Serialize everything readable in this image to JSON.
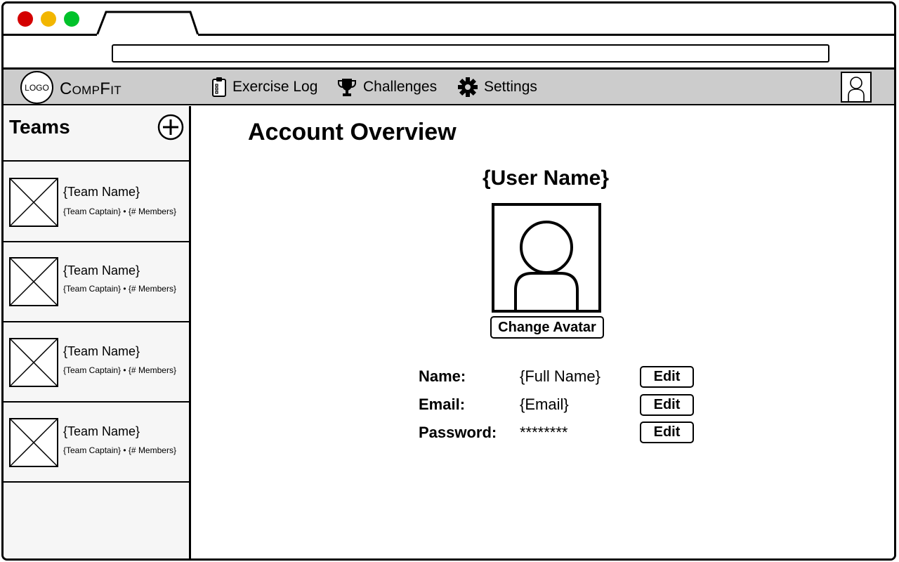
{
  "window": {
    "controls": {
      "close_color": "#d40000",
      "minimize_color": "#f2b600",
      "maximize_color": "#00c22a"
    },
    "tab_title": "",
    "url": ""
  },
  "nav": {
    "logo_text": "LOGO",
    "brand": "CompFit",
    "background": "#cccccc",
    "items": [
      {
        "label": "Exercise Log",
        "icon": "clipboard-icon"
      },
      {
        "label": "Challenges",
        "icon": "trophy-icon"
      },
      {
        "label": "Settings",
        "icon": "gear-icon"
      }
    ],
    "user_icon": "user-avatar-icon"
  },
  "sidebar": {
    "title": "Teams",
    "add_icon": "plus-circle-icon",
    "teams": [
      {
        "name": "{Team Name}",
        "meta": "{Team Captain} • {# Members}"
      },
      {
        "name": "{Team Name}",
        "meta": "{Team Captain} • {# Members}"
      },
      {
        "name": "{Team Name}",
        "meta": "{Team Captain} • {# Members}"
      },
      {
        "name": "{Team Name}",
        "meta": "{Team Captain} • {# Members}"
      }
    ]
  },
  "main": {
    "title": "Account Overview",
    "user_name": "{User Name}",
    "change_avatar_label": "Change Avatar",
    "fields": [
      {
        "label": "Name:",
        "value": "{Full Name}",
        "edit_label": "Edit"
      },
      {
        "label": "Email:",
        "value": "{Email}",
        "edit_label": "Edit"
      },
      {
        "label": "Password:",
        "value": "********",
        "edit_label": "Edit"
      }
    ]
  }
}
